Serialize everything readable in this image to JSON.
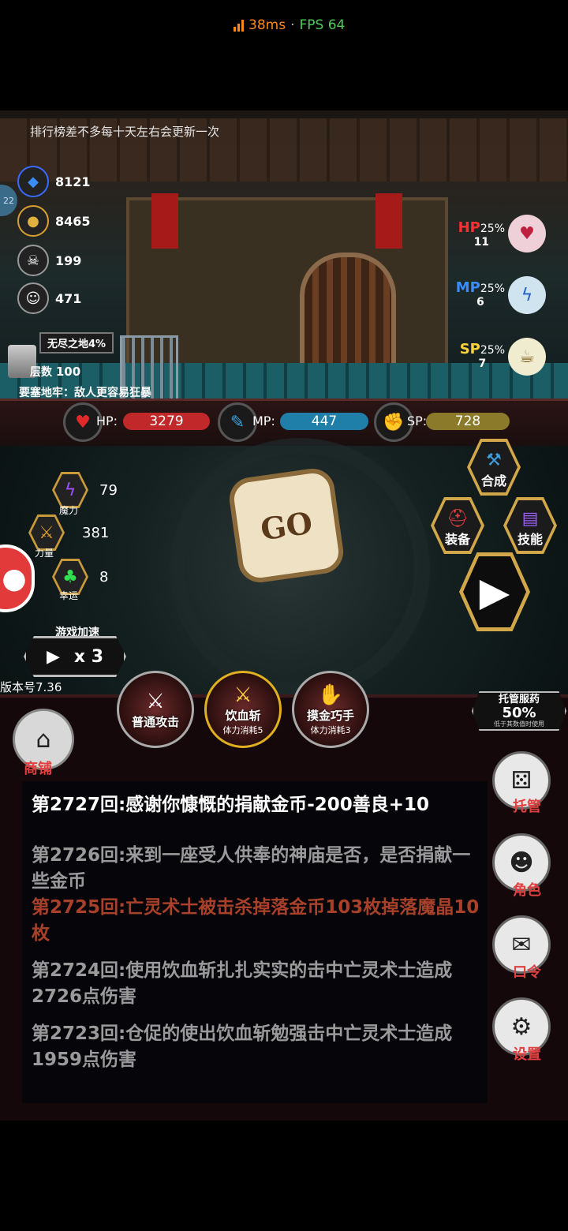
{
  "status": {
    "ping": "38ms",
    "separator": "·",
    "fps": "FPS 64"
  },
  "notice": "排行榜差不多每十天左右会更新一次",
  "side_badge": "22",
  "resources": [
    {
      "name": "宝石",
      "value": "8121",
      "icon": "gem-icon"
    },
    {
      "name": "金币",
      "value": "8465",
      "icon": "coin-icon"
    },
    {
      "name": "杀戮",
      "value": "199",
      "icon": "skull-icon"
    },
    {
      "name": "善恶",
      "value": "471",
      "icon": "mask-icon"
    }
  ],
  "dungeon": {
    "mode": "无尽之地4%",
    "floor_label": "层数",
    "floor": "100",
    "modifier": "要塞地牢：敌人更容易狂暴"
  },
  "potions": [
    {
      "type": "HP",
      "pct": "25%",
      "count": "11",
      "color": "#ff3030"
    },
    {
      "type": "MP",
      "pct": "25%",
      "count": "6",
      "color": "#3a8cff"
    },
    {
      "type": "SP",
      "pct": "25%",
      "count": "7",
      "color": "#ffd23a"
    }
  ],
  "stats": {
    "hp": {
      "label": "HP:",
      "value": "3279",
      "color": "#c0282a"
    },
    "mp": {
      "label": "MP:",
      "value": "447",
      "color": "#1f7fa8"
    },
    "sp": {
      "label": "SP:",
      "value": "728",
      "color": "#8a7a2a"
    }
  },
  "attributes": [
    {
      "name": "魔力",
      "value": "79",
      "icon": "magic-icon"
    },
    {
      "name": "力量",
      "value": "381",
      "icon": "strength-icon"
    },
    {
      "name": "幸运",
      "value": "8",
      "icon": "clover-icon"
    }
  ],
  "dice_label": "GO",
  "menu": {
    "craft": "合成",
    "equip": "装备",
    "skill": "技能"
  },
  "speed": {
    "label": "游戏加速",
    "value": "x 3"
  },
  "version": "版本号7.36",
  "skills": [
    {
      "name": "普通攻击",
      "cost": ""
    },
    {
      "name": "饮血斩",
      "cost": "体力消耗5"
    },
    {
      "name": "摸金巧手",
      "cost": "体力消耗3"
    }
  ],
  "auto_potion": {
    "title": "托管服药",
    "pct": "50%",
    "note": "低于其数值时使用"
  },
  "shop": "商铺",
  "side_menu": {
    "auto": "托管",
    "character": "角色",
    "code": "口令",
    "settings": "设置"
  },
  "log": [
    {
      "text": "第2727回:感谢你慷慨的捐献金币-200善良+10",
      "color": "#ffffff"
    },
    {
      "text": "第2726回:来到一座受人供奉的神庙是否，是否捐献一些金币",
      "color": "#9a9a9a"
    },
    {
      "text": "第2725回:亡灵术士被击杀掉落金币103枚掉落魔晶10枚",
      "color": "#a8402a"
    },
    {
      "text": "第2724回:使用饮血斩扎扎实实的击中亡灵术士造成2726点伤害",
      "color": "#9a9a9a"
    },
    {
      "text": "第2723回:仓促的使出饮血斩勉强击中亡灵术士造成1959点伤害",
      "color": "#9a9a9a"
    }
  ]
}
